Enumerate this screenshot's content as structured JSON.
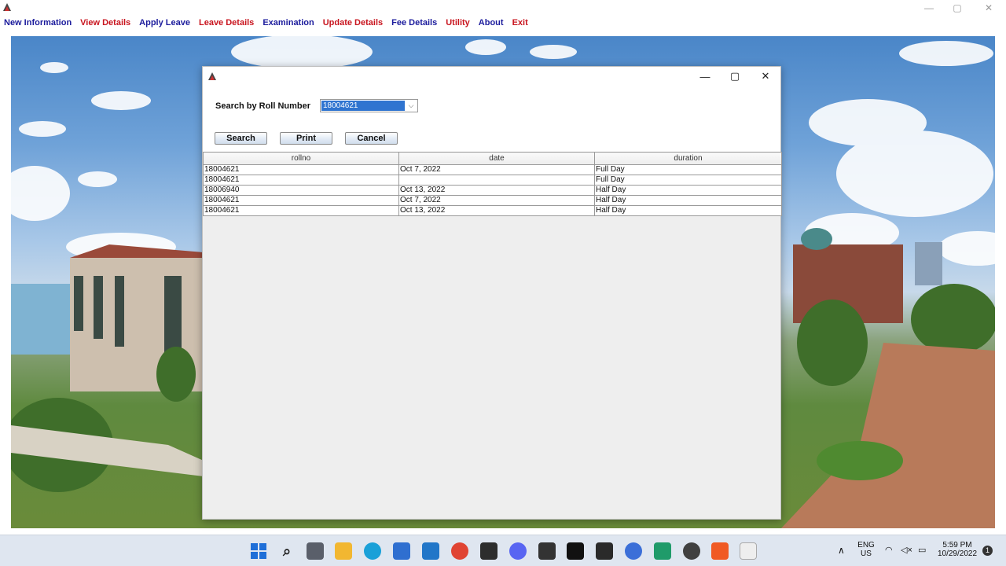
{
  "menu": [
    {
      "label": "New Information",
      "color": "#1b1b9c"
    },
    {
      "label": "View Details",
      "color": "#c8141e"
    },
    {
      "label": "Apply Leave",
      "color": "#1b1b9c"
    },
    {
      "label": "Leave Details",
      "color": "#c8141e"
    },
    {
      "label": "Examination",
      "color": "#1b1b9c"
    },
    {
      "label": "Update Details",
      "color": "#c8141e"
    },
    {
      "label": "Fee Details",
      "color": "#1b1b9c"
    },
    {
      "label": "Utility",
      "color": "#c8141e"
    },
    {
      "label": "About",
      "color": "#1b1b9c"
    },
    {
      "label": "Exit",
      "color": "#c8141e"
    }
  ],
  "dialog": {
    "search_label": "Search by Roll Number",
    "selected_roll": "18004621",
    "buttons": {
      "search": "Search",
      "print": "Print",
      "cancel": "Cancel"
    },
    "table": {
      "columns": [
        "rollno",
        "date",
        "duration"
      ],
      "rows": [
        [
          "18004621",
          "Oct 7, 2022",
          "Full Day"
        ],
        [
          "18004621",
          "",
          "Full Day"
        ],
        [
          "18006940",
          "Oct 13, 2022",
          "Half Day"
        ],
        [
          "18004621",
          "Oct 7, 2022",
          "Half Day"
        ],
        [
          "18004621",
          "Oct 13, 2022",
          "Half Day"
        ]
      ]
    }
  },
  "taskbar": {
    "language": "ENG",
    "region": "US",
    "time": "5:59 PM",
    "date": "10/29/2022",
    "notification_count": "1"
  }
}
